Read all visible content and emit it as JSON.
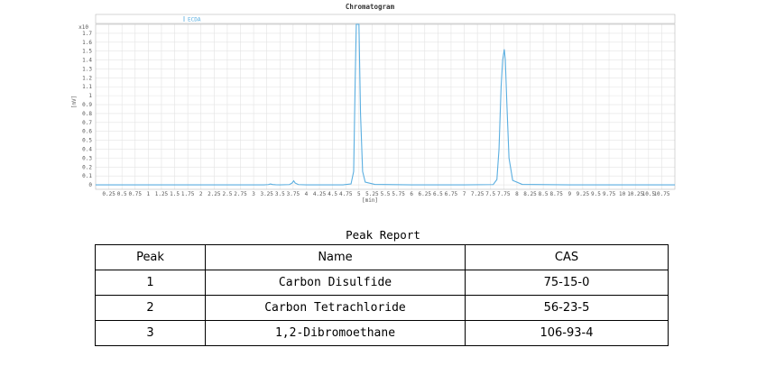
{
  "chart_data": {
    "type": "line",
    "title": "Chromatogram",
    "legend_label": "ECDA",
    "legend_position": "top-left",
    "xlabel": "[min]",
    "ylabel": "[mV]",
    "y_multiplier_label": "x10",
    "xlim": [
      0,
      11.0
    ],
    "ylim": [
      -0.05,
      1.8
    ],
    "grid": true,
    "x_ticks": [
      "0.25",
      "0.5",
      "0.75",
      "1",
      "1.25",
      "1.5",
      "1.75",
      "2",
      "2.25",
      "2.5",
      "2.75",
      "3",
      "3.25",
      "3.5",
      "3.75",
      "4",
      "4.25",
      "4.5",
      "4.75",
      "5",
      "5.25",
      "5.5",
      "5.75",
      "6",
      "6.25",
      "6.5",
      "6.75",
      "7",
      "7.25",
      "7.5",
      "7.75",
      "8",
      "8.25",
      "8.5",
      "8.75",
      "9",
      "9.25",
      "9.5",
      "9.75",
      "10",
      "10.25",
      "10.5",
      "10.75"
    ],
    "y_ticks": [
      "0",
      "0.1",
      "0.2",
      "0.3",
      "0.4",
      "0.5",
      "0.6",
      "0.7",
      "0.8",
      "0.9",
      "1",
      "1.1",
      "1.2",
      "1.3",
      "1.4",
      "1.5",
      "1.6",
      "1.7"
    ],
    "series": [
      {
        "name": "ECDA",
        "color": "#5aaee0",
        "x": [
          0,
          3.2,
          3.28,
          3.32,
          3.36,
          3.42,
          3.5,
          3.68,
          3.73,
          3.76,
          3.79,
          3.85,
          4.0,
          4.7,
          4.85,
          4.9,
          4.93,
          4.95,
          4.97,
          5.0,
          5.03,
          5.07,
          5.12,
          5.3,
          6.0,
          7.0,
          7.55,
          7.62,
          7.66,
          7.7,
          7.73,
          7.76,
          7.78,
          7.81,
          7.85,
          7.92,
          8.1,
          9.0,
          10.0,
          11.0
        ],
        "y": [
          0,
          0,
          0.003,
          0.01,
          0.004,
          0.001,
          0,
          0.003,
          0.02,
          0.045,
          0.02,
          0.003,
          0,
          0,
          0.01,
          0.15,
          1.2,
          1.85,
          1.85,
          1.85,
          0.8,
          0.15,
          0.03,
          0.005,
          0,
          0,
          0.003,
          0.06,
          0.4,
          1.1,
          1.4,
          1.52,
          1.4,
          0.9,
          0.3,
          0.05,
          0.005,
          0,
          0,
          0
        ]
      }
    ]
  },
  "report": {
    "title": "Peak Report",
    "headers": {
      "peak": "Peak",
      "name": "Name",
      "cas": "CAS"
    },
    "rows": [
      {
        "peak": "1",
        "name": "Carbon Disulfide",
        "cas": "75-15-0"
      },
      {
        "peak": "2",
        "name": "Carbon Tetrachloride",
        "cas": "56-23-5"
      },
      {
        "peak": "3",
        "name": "1,2-Dibromoethane",
        "cas": "106-93-4"
      }
    ]
  }
}
